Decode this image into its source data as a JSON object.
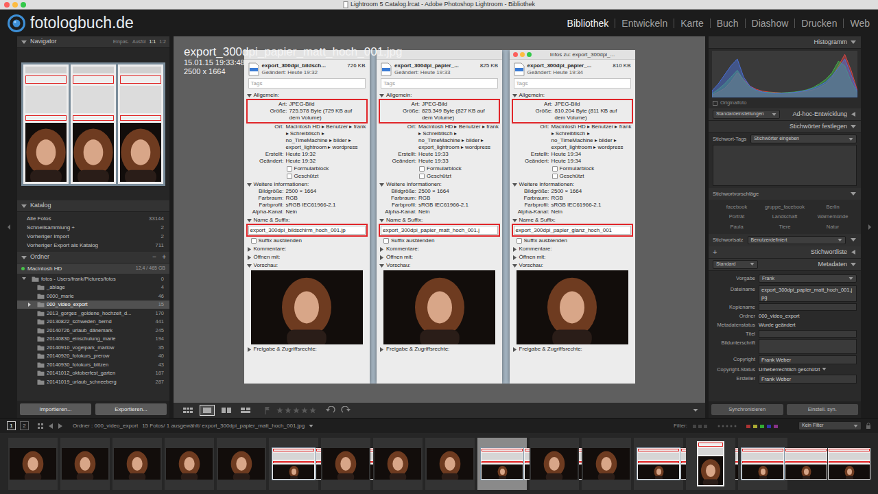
{
  "window": {
    "title": "Lightroom 5 Catalog.lrcat - Adobe Photoshop Lightroom - Bibliothek"
  },
  "logo": "fotologbuch.de",
  "modules": [
    {
      "label": "Bibliothek",
      "selected": true
    },
    {
      "label": "Entwickeln",
      "selected": false
    },
    {
      "label": "Karte",
      "selected": false
    },
    {
      "label": "Buch",
      "selected": false
    },
    {
      "label": "Diashow",
      "selected": false
    },
    {
      "label": "Drucken",
      "selected": false
    },
    {
      "label": "Web",
      "selected": false
    }
  ],
  "navigator": {
    "title": "Navigator",
    "expanded": true,
    "zoom": [
      {
        "label": "Einpas.",
        "selected": false
      },
      {
        "label": "Ausfül",
        "selected": false
      },
      {
        "label": "1:1",
        "selected": true
      },
      {
        "label": "1:2",
        "selected": false
      }
    ]
  },
  "catalog": {
    "title": "Katalog",
    "expanded": true,
    "items": [
      {
        "label": "Alle Fotos",
        "count": "33144"
      },
      {
        "label": "Schnellsammlung +",
        "count": "2"
      },
      {
        "label": "Vorheriger Import",
        "count": "2"
      },
      {
        "label": "Vorheriger Export als Katalog",
        "count": "711"
      }
    ]
  },
  "folders": {
    "title": "Ordner",
    "expanded": true,
    "minus": "−",
    "plus": "+",
    "volume": {
      "name": "Macintosh HD",
      "info": "12,4 / 465 GB"
    },
    "items": [
      {
        "label": "fotos - Users/frank/Pictures/fotos",
        "count": "0",
        "depth": 0,
        "twisty": "open",
        "selected": false
      },
      {
        "label": "_ablage",
        "count": "4",
        "depth": 1,
        "twisty": "none",
        "selected": false
      },
      {
        "label": "0000_marie",
        "count": "46",
        "depth": 1,
        "twisty": "none",
        "selected": false
      },
      {
        "label": "000_video_export",
        "count": "15",
        "depth": 1,
        "twisty": "closed",
        "selected": true
      },
      {
        "label": "2013_gorges _goldene_hochzeit_d...",
        "count": "170",
        "depth": 1,
        "twisty": "none",
        "selected": false
      },
      {
        "label": "20130822_schweden_bernd",
        "count": "441",
        "depth": 1,
        "twisty": "none",
        "selected": false
      },
      {
        "label": "20140726_urlaub_dänemark",
        "count": "245",
        "depth": 1,
        "twisty": "none",
        "selected": false
      },
      {
        "label": "20140830_einschulung_marie",
        "count": "194",
        "depth": 1,
        "twisty": "none",
        "selected": false
      },
      {
        "label": "20140910_vogelpark_marlow",
        "count": "35",
        "depth": 1,
        "twisty": "none",
        "selected": false
      },
      {
        "label": "20140920_fotokurs_prerow",
        "count": "40",
        "depth": 1,
        "twisty": "none",
        "selected": false
      },
      {
        "label": "20140930_fotokurs_blitzen",
        "count": "43",
        "depth": 1,
        "twisty": "none",
        "selected": false
      },
      {
        "label": "20141012_oktoberfest_garten",
        "count": "187",
        "depth": 1,
        "twisty": "none",
        "selected": false
      },
      {
        "label": "20141019_urlaub_schneeberg",
        "count": "287",
        "depth": 1,
        "twisty": "none",
        "selected": false
      }
    ]
  },
  "import_export": [
    "Importieren...",
    "Exportieren..."
  ],
  "loupe_info": {
    "filename": "export_300dpi_papier_matt_hoch_001.jpg",
    "date": "15.01.15 19:33:48",
    "dimensions": "2500 x 1664"
  },
  "info_windows": [
    {
      "active": false,
      "name": "export_300dpi_bildsch...",
      "size": "726 KB",
      "modified": "Geändert: Heute 19:32",
      "tags_placeholder": "Tags",
      "general": {
        "title": "Allgemein:",
        "expanded": true,
        "rows": [
          {
            "label": "Art:",
            "value": "JPEG-Bild",
            "highlight": true
          },
          {
            "label": "Größe:",
            "value": "725.578 Byte (729 KB auf dem Volume)",
            "highlight": true
          },
          {
            "label": "Ort:",
            "value": "Macintosh HD ▸ Benutzer ▸ frank ▸ Schreibtisch ▸ no_TimeMachine ▸ bilder ▸ export_lightroom ▸ wordpress",
            "highlight": false
          },
          {
            "label": "Erstellt:",
            "value": "Heute 19:32",
            "highlight": false
          },
          {
            "label": "Geändert:",
            "value": "Heute 19:32",
            "highlight": false
          }
        ],
        "checkboxes": [
          {
            "label": "Formularblock",
            "checked": false
          },
          {
            "label": "Geschützt",
            "checked": false
          }
        ]
      },
      "more": {
        "title": "Weitere Informationen:",
        "expanded": true,
        "rows": [
          {
            "label": "Bildgröße:",
            "value": "2500 × 1664",
            "highlight": false
          },
          {
            "label": "Farbraum:",
            "value": "RGB",
            "highlight": false
          },
          {
            "label": "Farbprofil:",
            "value": "sRGB IEC61966-2.1",
            "highlight": false
          },
          {
            "label": "Alpha-Kanal:",
            "value": "Nein",
            "highlight": false
          }
        ]
      },
      "name_section": {
        "title": "Name & Suffix:",
        "expanded": true,
        "value": "export_300dpi_bildschirm_hoch_001.jp",
        "highlight": true,
        "checkbox": {
          "label": "Suffix ausblenden",
          "checked": false
        }
      },
      "sections": [
        {
          "label": "Kommentare:",
          "expanded": false
        },
        {
          "label": "Öffnen mit:",
          "expanded": false
        },
        {
          "label": "Vorschau:",
          "expanded": true
        },
        {
          "label": "Freigabe & Zugriffsrechte:",
          "expanded": false
        }
      ]
    },
    {
      "active": false,
      "name": "export_300dpi_papier_...",
      "size": "825 KB",
      "modified": "Geändert: Heute 19:33",
      "tags_placeholder": "Tags",
      "general": {
        "title": "Allgemein:",
        "expanded": true,
        "rows": [
          {
            "label": "Art:",
            "value": "JPEG-Bild",
            "highlight": true
          },
          {
            "label": "Größe:",
            "value": "825.349 Byte (827 KB auf dem Volume)",
            "highlight": true
          },
          {
            "label": "Ort:",
            "value": "Macintosh HD ▸ Benutzer ▸ frank ▸ Schreibtisch ▸ no_TimeMachine ▸ bilder ▸ export_lightroom ▸ wordpress",
            "highlight": false
          },
          {
            "label": "Erstellt:",
            "value": "Heute 19:33",
            "highlight": false
          },
          {
            "label": "Geändert:",
            "value": "Heute 19:33",
            "highlight": false
          }
        ],
        "checkboxes": [
          {
            "label": "Formularblock",
            "checked": false
          },
          {
            "label": "Geschützt",
            "checked": false
          }
        ]
      },
      "more": {
        "title": "Weitere Informationen:",
        "expanded": true,
        "rows": [
          {
            "label": "Bildgröße:",
            "value": "2500 × 1664",
            "highlight": false
          },
          {
            "label": "Farbraum:",
            "value": "RGB",
            "highlight": false
          },
          {
            "label": "Farbprofil:",
            "value": "sRGB IEC61966-2.1",
            "highlight": false
          },
          {
            "label": "Alpha-Kanal:",
            "value": "Nein",
            "highlight": false
          }
        ]
      },
      "name_section": {
        "title": "Name & Suffix:",
        "expanded": true,
        "value": "export_300dpi_papier_matt_hoch_001.j",
        "highlight": true,
        "checkbox": {
          "label": "Suffix ausblenden",
          "checked": false
        }
      },
      "sections": [
        {
          "label": "Kommentare:",
          "expanded": false
        },
        {
          "label": "Öffnen mit:",
          "expanded": false
        },
        {
          "label": "Vorschau:",
          "expanded": true
        },
        {
          "label": "Freigabe & Zugriffsrechte:",
          "expanded": false
        }
      ]
    },
    {
      "active": true,
      "title": "Infos zu: export_300dpi_...",
      "name": "export_300dpi_papier_...",
      "size": "810 KB",
      "modified": "Geändert: Heute 19:34",
      "tags_placeholder": "Tags",
      "general": {
        "title": "Allgemein:",
        "expanded": true,
        "rows": [
          {
            "label": "Art:",
            "value": "JPEG-Bild",
            "highlight": true
          },
          {
            "label": "Größe:",
            "value": "810.204 Byte (811 KB auf dem Volume)",
            "highlight": true
          },
          {
            "label": "Ort:",
            "value": "Macintosh HD ▸ Benutzer ▸ frank ▸ Schreibtisch ▸ no_TimeMachine ▸ bilder ▸ export_lightroom ▸ wordpress",
            "highlight": false
          },
          {
            "label": "Erstellt:",
            "value": "Heute 19:34",
            "highlight": false
          },
          {
            "label": "Geändert:",
            "value": "Heute 19:34",
            "highlight": false
          }
        ],
        "checkboxes": [
          {
            "label": "Formularblock",
            "checked": false
          },
          {
            "label": "Geschützt",
            "checked": false
          }
        ]
      },
      "more": {
        "title": "Weitere Informationen:",
        "expanded": true,
        "rows": [
          {
            "label": "Bildgröße:",
            "value": "2500 × 1664",
            "highlight": false
          },
          {
            "label": "Farbraum:",
            "value": "RGB",
            "highlight": false
          },
          {
            "label": "Farbprofil:",
            "value": "sRGB IEC61966-2.1",
            "highlight": false
          },
          {
            "label": "Alpha-Kanal:",
            "value": "Nein",
            "highlight": false
          }
        ]
      },
      "name_section": {
        "title": "Name & Suffix:",
        "expanded": true,
        "value": "export_300dpi_papier_glanz_hoch_001",
        "highlight": true,
        "checkbox": {
          "label": "Suffix ausblenden",
          "checked": false
        }
      },
      "sections": [
        {
          "label": "Kommentare:",
          "expanded": false
        },
        {
          "label": "Öffnen mit:",
          "expanded": false
        },
        {
          "label": "Vorschau:",
          "expanded": true
        },
        {
          "label": "Freigabe & Zugriffsrechte:",
          "expanded": false
        }
      ]
    }
  ],
  "toolbar": {
    "views": [
      {
        "kind": "grid",
        "selected": false
      },
      {
        "kind": "loupe",
        "selected": true
      },
      {
        "kind": "compare",
        "selected": false
      },
      {
        "kind": "survey",
        "selected": false
      }
    ],
    "stars": 0
  },
  "histogram": {
    "title": "Histogramm",
    "expanded": true,
    "series": [
      {
        "name": "red",
        "color": "#d64545",
        "values": [
          5,
          12,
          20,
          35,
          55,
          40,
          25,
          18,
          14,
          12,
          11,
          10,
          10,
          11,
          12,
          14,
          17,
          22,
          30,
          45,
          70,
          95,
          60,
          15
        ]
      },
      {
        "name": "green",
        "color": "#45b04a",
        "values": [
          8,
          18,
          30,
          45,
          60,
          38,
          22,
          15,
          12,
          11,
          10,
          10,
          11,
          12,
          14,
          17,
          22,
          30,
          40,
          55,
          80,
          70,
          35,
          10
        ]
      },
      {
        "name": "blue",
        "color": "#4a6fd6",
        "values": [
          15,
          30,
          50,
          70,
          85,
          45,
          25,
          16,
          12,
          10,
          9,
          9,
          10,
          11,
          13,
          16,
          20,
          26,
          34,
          48,
          65,
          85,
          50,
          12
        ]
      }
    ],
    "original_photo": {
      "label": "Originalfoto",
      "checked": false
    }
  },
  "quick_develop": {
    "preset": "Standardeinstellungen",
    "title": "Ad-hoc-Entwicklung",
    "expanded": false
  },
  "keywording": {
    "title": "Stichwörter festlegen",
    "expanded": true,
    "tags_label": "Stichwort-Tags",
    "tags_select": "Stichwörter eingeben",
    "suggestions_title": "Stichwortvorschläge",
    "suggestions_expanded": true,
    "suggestions": [
      "facebook",
      "gruppe_facebook",
      "Berlin",
      "Porträt",
      "Landschaft",
      "Warnemünde",
      "Paula",
      "Tiere",
      "Natur"
    ],
    "set_label": "Stichwortsatz",
    "set_value": "Benutzerdefiniert",
    "set_expanded": true
  },
  "keyword_list": {
    "plus": "+",
    "title": "Stichwortliste",
    "expanded": false
  },
  "metadata": {
    "view": "Standard",
    "title": "Metadaten",
    "expanded": true,
    "preset_label": "Vorgabe",
    "preset_value": "Frank",
    "fields": [
      {
        "label": "Dateiname",
        "value": "export_300dpi_papier_matt_hoch_001.jpg",
        "kind": "box"
      },
      {
        "label": "Kopiename",
        "kind": "box"
      },
      {
        "label": "Ordner",
        "value": "000_video_export",
        "kind": "text"
      },
      {
        "label": "Metadatenstatus",
        "value": "Wurde geändert",
        "kind": "text"
      },
      {
        "label": "Titel",
        "kind": "box"
      },
      {
        "label": "Bildunterschrift",
        "kind": "area"
      },
      {
        "label": "Copyright",
        "value": "Frank Weber",
        "kind": "box"
      },
      {
        "label": "Copyright-Status",
        "value": "Urheberrechtlich geschützt",
        "kind": "select"
      },
      {
        "label": "Ersteller",
        "value": "Frank Weber",
        "kind": "box"
      }
    ]
  },
  "sync_buttons": [
    "Synchronisieren",
    "Einstell. syn."
  ],
  "filmstrip_bar": {
    "pages": [
      {
        "label": "1",
        "selected": true
      },
      {
        "label": "2",
        "selected": false
      }
    ],
    "source": "Ordner : 000_video_export",
    "info": "15 Fotos/ 1 ausgewählt/ export_300dpi_papier_matt_hoch_001.jpg",
    "filter_label": "Filter:",
    "filter_value": "Kein Filter"
  },
  "filmstrip": [
    {
      "kind": "photo",
      "selected": false
    },
    {
      "kind": "photo",
      "selected": false
    },
    {
      "kind": "photo",
      "selected": false
    },
    {
      "kind": "photo",
      "selected": false
    },
    {
      "kind": "photo",
      "selected": false
    },
    {
      "kind": "screenshot",
      "selected": false
    },
    {
      "kind": "photo",
      "selected": false
    },
    {
      "kind": "photo",
      "selected": false
    },
    {
      "kind": "photo",
      "selected": false
    },
    {
      "kind": "screenshot",
      "selected": true
    },
    {
      "kind": "photo",
      "selected": false
    },
    {
      "kind": "photo",
      "selected": false
    },
    {
      "kind": "screenshot",
      "selected": false
    },
    {
      "kind": "tall",
      "selected": false
    },
    {
      "kind": "screenshot",
      "selected": false
    }
  ]
}
